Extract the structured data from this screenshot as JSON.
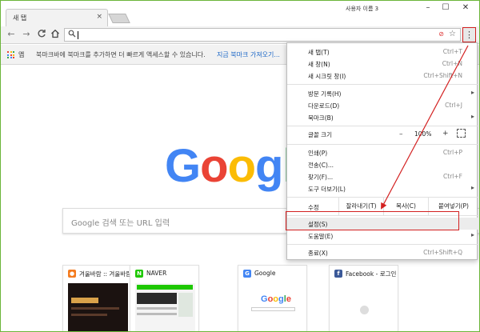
{
  "window": {
    "tab_title": "새 탭",
    "tab_close": "×",
    "user_label": "사용자 이름 3",
    "min": "–",
    "max": "☐",
    "close": "✕"
  },
  "toolbar": {
    "back": "←",
    "forward": "→",
    "reload": "C",
    "home": "⌂",
    "search_icon": "⚲",
    "menu": "⋮",
    "star": "☆",
    "block": "⊘"
  },
  "bookmarks": {
    "apps_label": "앱",
    "message": "북마크바에 북마크를 추가하면 더 빠르게 액세스할 수 있습니다.",
    "import_link": "지금 북마크 가져오기..."
  },
  "content": {
    "logo": [
      "G",
      "o",
      "o",
      "g",
      "l",
      "e"
    ],
    "logo_colors": [
      "#4285f4",
      "#ea4335",
      "#fbbc05",
      "#4285f4",
      "#34a853",
      "#ea4335"
    ],
    "search_placeholder": "Google 검색 또는 URL 입력",
    "tiles": [
      {
        "title": "겨울바람 :: 겨울바람",
        "fav": "●",
        "fav_color": "#f47c20"
      },
      {
        "title": "NAVER",
        "fav": "N",
        "fav_color": "#1ec800"
      },
      {
        "title": "Google",
        "fav": "G",
        "fav_color": "#4285f4"
      },
      {
        "title": "Facebook - 로그인",
        "fav": "f",
        "fav_color": "#3b5998"
      }
    ]
  },
  "menu": {
    "new_tab": {
      "label": "새 탭(T)",
      "shortcut": "Ctrl+T"
    },
    "new_window": {
      "label": "새 창(N)",
      "shortcut": "Ctrl+N"
    },
    "incognito": {
      "label": "새 시크릿 창(I)",
      "shortcut": "Ctrl+Shift+N"
    },
    "history": {
      "label": "방문 기록(H)",
      "arrow": "▸"
    },
    "downloads": {
      "label": "다운로드(D)",
      "shortcut": "Ctrl+J"
    },
    "bookmarks": {
      "label": "북마크(B)",
      "arrow": "▸"
    },
    "zoom": {
      "label": "글꼴 크기",
      "minus": "–",
      "value": "100%",
      "plus": "+"
    },
    "print": {
      "label": "인쇄(P)",
      "shortcut": "Ctrl+P"
    },
    "cast": {
      "label": "전송(C)..."
    },
    "find": {
      "label": "찾기(F)...",
      "shortcut": "Ctrl+F"
    },
    "more_tools": {
      "label": "도구 더보기(L)",
      "arrow": "▸"
    },
    "edit": {
      "label": "수정",
      "cut": "잘라내기(T)",
      "copy": "복사(C)",
      "paste": "붙여넣기(P)"
    },
    "settings": {
      "label": "설정(S)"
    },
    "help": {
      "label": "도움말(E)",
      "arrow": "▸"
    },
    "exit": {
      "label": "종료(X)",
      "shortcut": "Ctrl+Shift+Q"
    }
  },
  "annotation_color": "#d32020"
}
